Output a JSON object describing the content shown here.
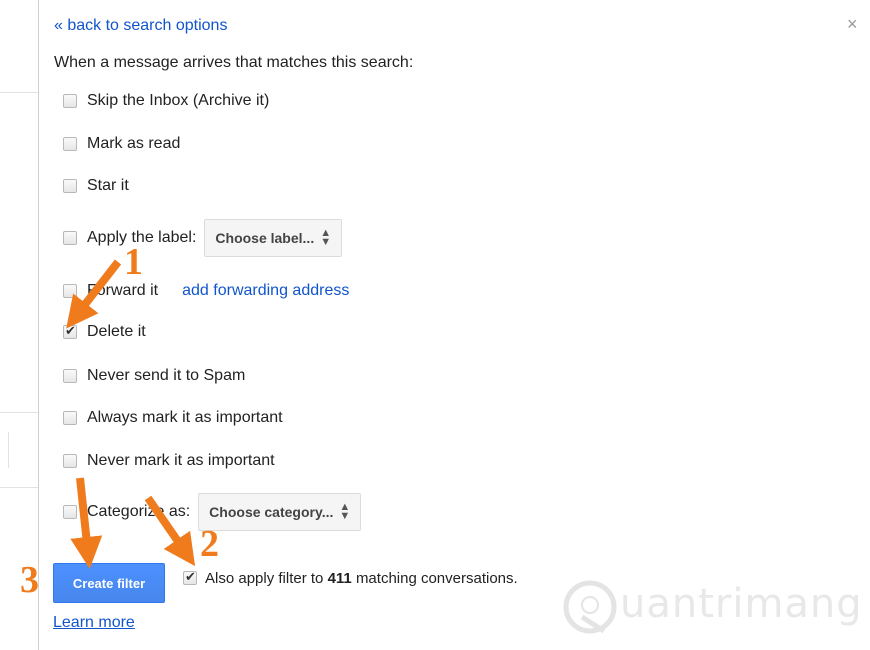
{
  "dialog": {
    "back_link": "« back to search options",
    "close": "×",
    "intro": "When a message arrives that matches this search:"
  },
  "options": [
    {
      "label": "Skip the Inbox (Archive it)",
      "checked": false
    },
    {
      "label": "Mark as read",
      "checked": false
    },
    {
      "label": "Star it",
      "checked": false
    },
    {
      "label": "Apply the label:",
      "checked": false,
      "select": "Choose label..."
    },
    {
      "label": "Forward it",
      "checked": false,
      "link": "add forwarding address"
    },
    {
      "label": "Delete it",
      "checked": true
    },
    {
      "label": "Never send it to Spam",
      "checked": false
    },
    {
      "label": "Always mark it as important",
      "checked": false
    },
    {
      "label": "Never mark it as important",
      "checked": false
    },
    {
      "label": "Categorize as:",
      "checked": false,
      "select": "Choose category..."
    }
  ],
  "footer": {
    "create_button": "Create filter",
    "apply_prefix": "Also apply filter to",
    "apply_count": "411",
    "apply_suffix": "matching conversations.",
    "apply_checked": true,
    "learn_more": "Learn more"
  },
  "annotations": {
    "one": "1",
    "two": "2",
    "three": "3",
    "color": "#f07b1d"
  },
  "watermark": {
    "text": "uantrimang",
    "icon": "lightbulb-q-icon"
  },
  "colors": {
    "link": "#1155cc",
    "button": "#4d90fe"
  }
}
